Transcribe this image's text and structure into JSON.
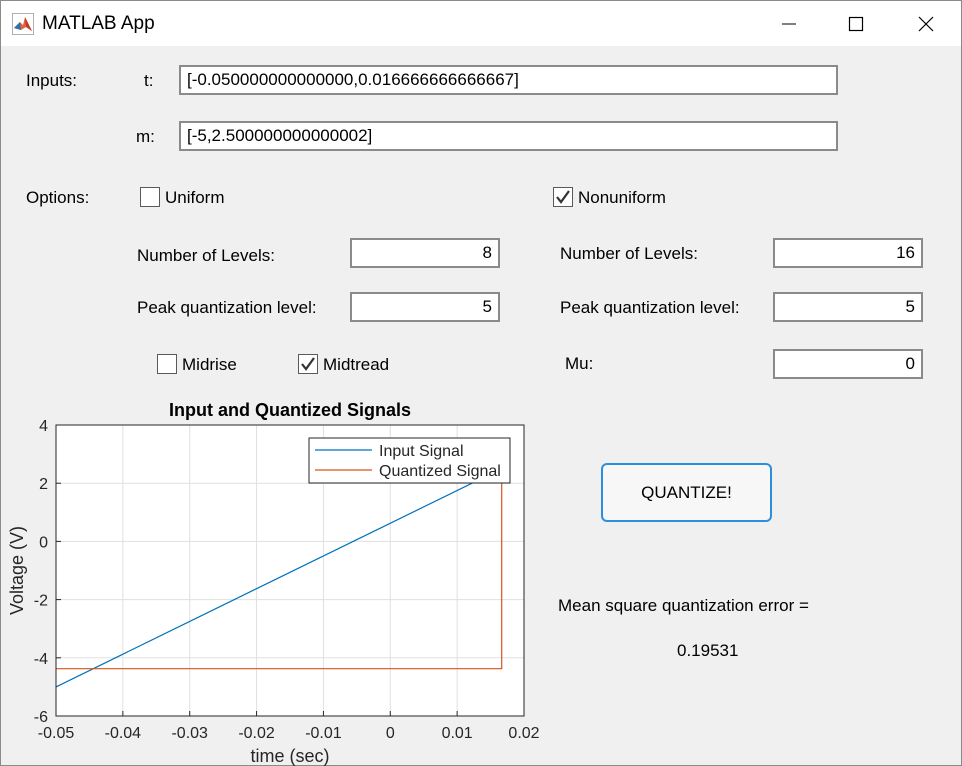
{
  "window": {
    "title": "MATLAB App",
    "icons": [
      "matlab-logo-icon",
      "minimize-icon",
      "maximize-icon",
      "close-icon"
    ]
  },
  "inputs": {
    "section_label": "Inputs:",
    "t_label": "t:",
    "t_value": "[-0.050000000000000,0.016666666666667]",
    "m_label": "m:",
    "m_value": "[-5,2.500000000000002]"
  },
  "options": {
    "section_label": "Options:",
    "uniform": {
      "label": "Uniform",
      "checked": false,
      "levels_label": "Number of Levels:",
      "levels_value": "8",
      "peak_label": "Peak quantization level:",
      "peak_value": "5",
      "midrise_label": "Midrise",
      "midrise_checked": false,
      "midtread_label": "Midtread",
      "midtread_checked": true
    },
    "nonuniform": {
      "label": "Nonuniform",
      "checked": true,
      "levels_label": "Number of Levels:",
      "levels_value": "16",
      "peak_label": "Peak quantization level:",
      "peak_value": "5",
      "mu_label": "Mu:",
      "mu_value": "0"
    }
  },
  "actions": {
    "quantize_label": "QUANTIZE!"
  },
  "result": {
    "label": "Mean square quantization error =",
    "value": "0.19531"
  },
  "chart_data": {
    "type": "line",
    "title": "Input and Quantized Signals",
    "xlabel": "time (sec)",
    "ylabel": "Voltage (V)",
    "xlim": [
      -0.05,
      0.02
    ],
    "ylim": [
      -6,
      4
    ],
    "x_ticks": [
      -0.05,
      -0.04,
      -0.03,
      -0.02,
      -0.01,
      0,
      0.01,
      0.02
    ],
    "y_ticks": [
      -6,
      -4,
      -2,
      0,
      2,
      4
    ],
    "x_tick_labels": [
      "-0.05",
      "-0.04",
      "-0.03",
      "-0.02",
      "-0.01",
      "0",
      "0.01",
      "0.02"
    ],
    "y_tick_labels": [
      "-6",
      "-4",
      "-2",
      "0",
      "2",
      "4"
    ],
    "grid": true,
    "legend_position": "top-right",
    "series": [
      {
        "name": "Input Signal",
        "color": "#0072bd",
        "x": [
          -0.05,
          0.016667
        ],
        "y": [
          -5,
          2.5
        ]
      },
      {
        "name": "Quantized Signal",
        "color": "#d95319",
        "x": [
          -0.05,
          0.016667,
          0.016667
        ],
        "y": [
          -4.375,
          -4.375,
          2.5
        ]
      }
    ]
  }
}
